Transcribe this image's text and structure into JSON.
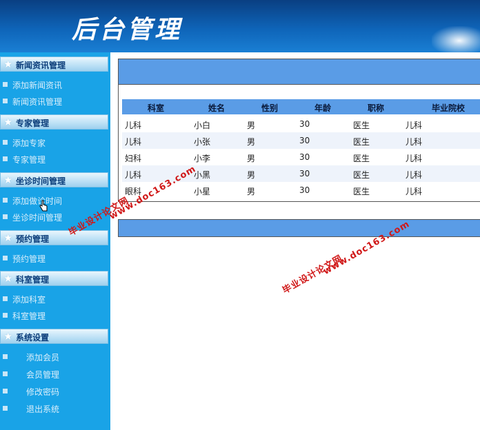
{
  "header": {
    "title": "后台管理"
  },
  "sidebar": {
    "groups": [
      {
        "title": "新闻资讯管理",
        "items": [
          "添加新闻资讯",
          "新闻资讯管理"
        ]
      },
      {
        "title": "专家管理",
        "items": [
          "添加专家",
          "专家管理"
        ]
      },
      {
        "title": "坐诊时间管理",
        "items": [
          "添加做诊时间",
          "坐诊时间管理"
        ]
      },
      {
        "title": "预约管理",
        "items": [
          "预约管理"
        ]
      },
      {
        "title": "科室管理",
        "items": [
          "添加科室",
          "科室管理"
        ]
      },
      {
        "title": "系统设置",
        "items": [
          "添加会员",
          "会员管理",
          "修改密码",
          "退出系统"
        ]
      }
    ]
  },
  "table": {
    "columns": [
      "科室",
      "姓名",
      "性别",
      "年龄",
      "职称",
      "毕业院校"
    ],
    "rows": [
      [
        "儿科",
        "小白",
        "男",
        "30",
        "医生",
        "儿科"
      ],
      [
        "儿科",
        "小张",
        "男",
        "30",
        "医生",
        "儿科"
      ],
      [
        "妇科",
        "小李",
        "男",
        "30",
        "医生",
        "儿科"
      ],
      [
        "儿科",
        "小黑",
        "男",
        "30",
        "医生",
        "儿科"
      ],
      [
        "眼科",
        "小星",
        "男",
        "30",
        "医生",
        "儿科"
      ]
    ]
  },
  "watermarks": [
    {
      "line1": "毕业设计论文网",
      "line2": "www.doc163.com"
    },
    {
      "line1": "毕业设计论文网",
      "line2": "www.doc163.com"
    }
  ],
  "colors": {
    "banner": "#0e64b8",
    "sidebar": "#19a3e7",
    "table_header": "#5a9ce6",
    "watermark": "#d01818"
  }
}
